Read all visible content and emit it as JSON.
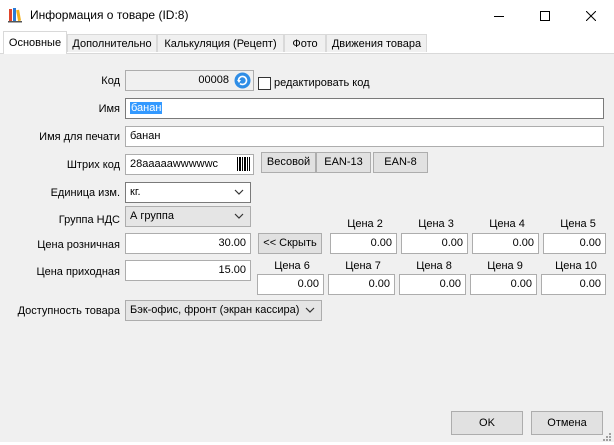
{
  "window": {
    "title": "Информация о товаре (ID:8)",
    "accent": "#3399ff"
  },
  "tabs": [
    {
      "label": "Основные",
      "active": true
    },
    {
      "label": "Дополнительно",
      "active": false
    },
    {
      "label": "Калькуляция (Рецепт)",
      "active": false
    },
    {
      "label": "Фото",
      "active": false
    },
    {
      "label": "Движения товара",
      "active": false
    }
  ],
  "form": {
    "code_label": "Код",
    "code_value": "00008",
    "edit_code_label": "редактировать код",
    "edit_code_checked": false,
    "name_label": "Имя",
    "name_value": "банан",
    "print_name_label": "Имя для печати",
    "print_name_value": "банан",
    "barcode_label": "Штрих код",
    "barcode_value": "28aaaaawwwwwc",
    "weight_button": "Весовой",
    "ean13_button": "EAN-13",
    "ean8_button": "EAN-8",
    "unit_label": "Единица изм.",
    "unit_value": "кг.",
    "vat_label": "Группа НДС",
    "vat_value": "А группа",
    "retail_price_label": "Цена розничная",
    "retail_price_value": "30.00",
    "hide_button": "<< Скрыть",
    "purchase_price_label": "Цена приходная",
    "purchase_price_value": "15.00",
    "availability_label": "Доступность товара",
    "availability_value": "Бэк-офис, фронт (экран кассира)"
  },
  "prices": [
    {
      "label": "Цена 2",
      "value": "0.00"
    },
    {
      "label": "Цена 3",
      "value": "0.00"
    },
    {
      "label": "Цена 4",
      "value": "0.00"
    },
    {
      "label": "Цена 5",
      "value": "0.00"
    },
    {
      "label": "Цена 6",
      "value": "0.00"
    },
    {
      "label": "Цена 7",
      "value": "0.00"
    },
    {
      "label": "Цена 8",
      "value": "0.00"
    },
    {
      "label": "Цена 9",
      "value": "0.00"
    },
    {
      "label": "Цена 10",
      "value": "0.00"
    }
  ],
  "footer": {
    "ok_label": "OK",
    "cancel_label": "Отмена"
  },
  "icons": {
    "app": "books-icon",
    "refresh": "refresh-icon",
    "barcode": "barcode-icon",
    "minimize": "minimize-icon",
    "maximize": "maximize-icon",
    "close": "close-icon",
    "dropdown": "chevron-down-icon"
  }
}
